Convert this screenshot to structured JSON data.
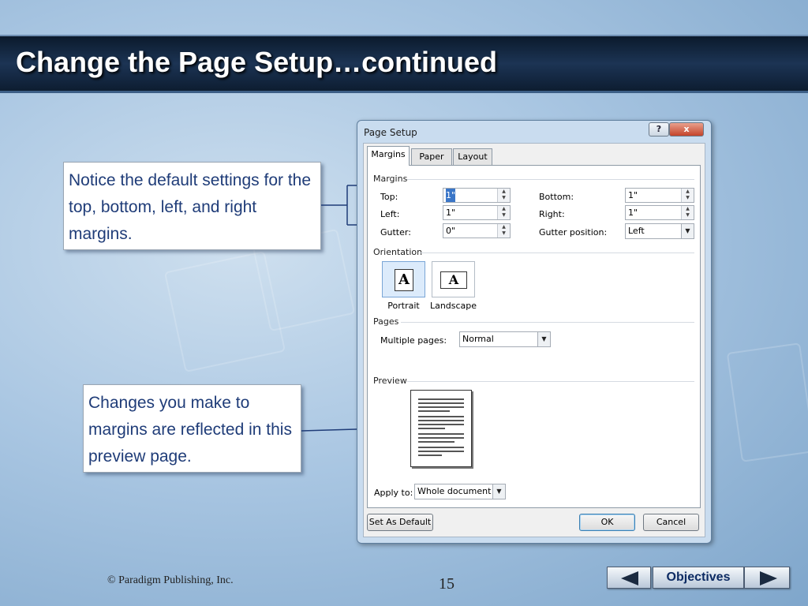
{
  "slide": {
    "title": "Change the Page Setup…continued",
    "footer": "© Paradigm Publishing, Inc.",
    "page_number": "15"
  },
  "callouts": {
    "margins_note": "Notice the default settings for the top, bottom, left, and right margins.",
    "preview_note": "Changes you make to margins are reflected in this preview page."
  },
  "dialog": {
    "title": "Page Setup",
    "help_label": "?",
    "close_label": "x",
    "tabs": [
      {
        "label": "Margins",
        "active": true
      },
      {
        "label": "Paper",
        "active": false
      },
      {
        "label": "Layout",
        "active": false
      }
    ],
    "margins_group": "Margins",
    "fields": {
      "top_label": "Top:",
      "top_value": "1\"",
      "bottom_label": "Bottom:",
      "bottom_value": "1\"",
      "left_label": "Left:",
      "left_value": "1\"",
      "right_label": "Right:",
      "right_value": "1\"",
      "gutter_label": "Gutter:",
      "gutter_value": "0\"",
      "gutter_position_label": "Gutter position:",
      "gutter_position_value": "Left"
    },
    "orientation_group": "Orientation",
    "orientation": {
      "portrait_label": "Portrait",
      "landscape_label": "Landscape",
      "selected": "Portrait",
      "icon_letter": "A"
    },
    "pages_group": "Pages",
    "multiple_pages_label": "Multiple pages:",
    "multiple_pages_value": "Normal",
    "preview_group": "Preview",
    "apply_to_label": "Apply to:",
    "apply_to_value": "Whole document",
    "buttons": {
      "set_default": "Set As Default",
      "ok": "OK",
      "cancel": "Cancel"
    }
  },
  "nav": {
    "objectives_label": "Objectives"
  }
}
